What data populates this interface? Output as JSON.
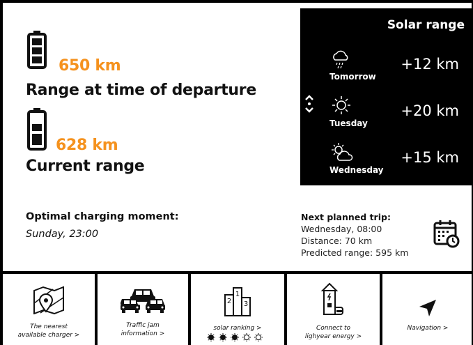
{
  "departure": {
    "value": "650 km",
    "label": "Range at time of departure"
  },
  "current": {
    "value": "628 km",
    "label": "Current range"
  },
  "solar": {
    "title": "Solar range",
    "days": [
      {
        "day": "Tomorrow",
        "km": "+12 km",
        "icon": "rain-cloud-icon"
      },
      {
        "day": "Tuesday",
        "km": "+20 km",
        "icon": "sun-icon"
      },
      {
        "day": "Wednesday",
        "km": "+15 km",
        "icon": "partly-cloudy-icon"
      }
    ]
  },
  "optimal": {
    "title": "Optimal charging moment:",
    "value": "Sunday, 23:00"
  },
  "trip": {
    "title": "Next planned trip:",
    "when": "Wednesday, 08:00",
    "distance": "Distance: 70 km",
    "predicted": "Predicted range: 595 km"
  },
  "tiles": {
    "charger": [
      "The nearest",
      "available charger >"
    ],
    "traffic": [
      "Traffic jam",
      "information >"
    ],
    "solar_ranking": "solar ranking >",
    "connect": [
      "Connect to",
      "lighyear energy >"
    ],
    "navigation": "Navigation >"
  },
  "colors": {
    "accent": "#f5921e",
    "panel": "#000000"
  }
}
